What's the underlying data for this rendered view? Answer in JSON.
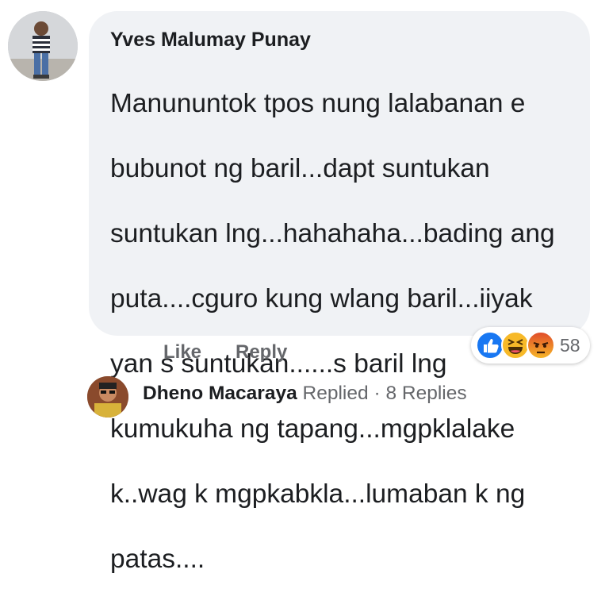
{
  "comment": {
    "author": "Yves Malumay Punay",
    "lines": [
      "Manununtok tpos nung lalabanan e",
      "bubunot ng baril...dapt suntukan",
      "suntukan lng...hahahaha...bading ang",
      "puta....cguro kung wlang baril...iiyak",
      "yan s suntukan......s baril lng",
      "kumukuha ng tapang...mgpklalake",
      "k..wag k mgpkabkla...lumaban k ng",
      "patas...."
    ],
    "like_label": "Like",
    "reply_label": "Reply",
    "reactions": {
      "icons": [
        "like-reaction-icon",
        "haha-reaction-icon",
        "angry-reaction-icon"
      ],
      "count": "58",
      "colors": {
        "like": "#1877f2",
        "haha": "#f7b928",
        "angry": "#f15c2c"
      }
    }
  },
  "reply_summary": {
    "name": "Dheno Macaraya",
    "action": "Replied",
    "separator": "·",
    "count_label": "8 Replies"
  }
}
